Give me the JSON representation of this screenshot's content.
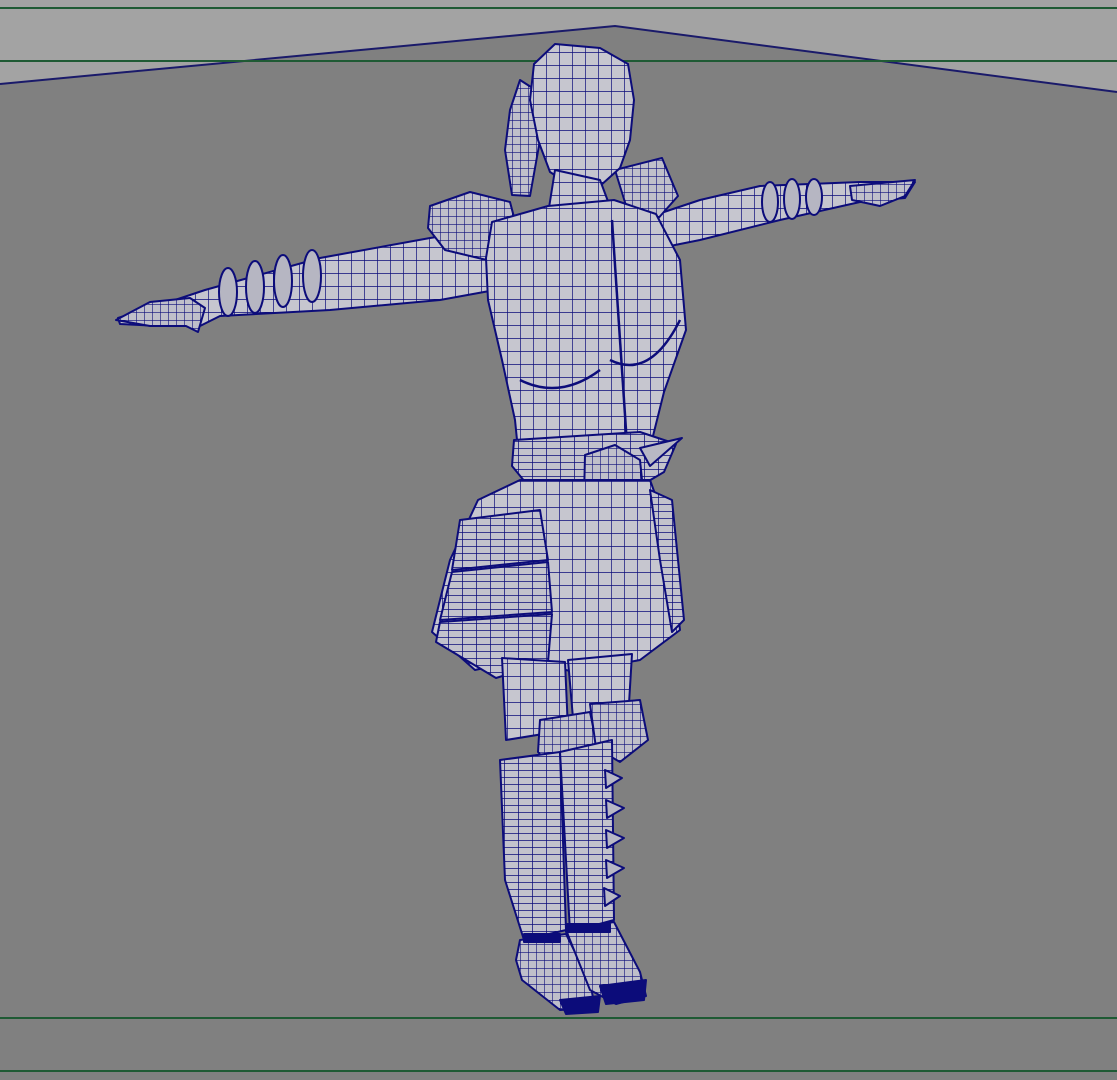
{
  "viewport": {
    "panel": "3d-perspective-viewport",
    "shading": "wireframe-on-shaded",
    "colors": {
      "background": "#808080",
      "backdrop_wall": "#a3a3a3",
      "mesh_fill": "#c6c6cf",
      "wireframe": "#0c0c7a",
      "resolution_gate": "#1f5a34"
    }
  },
  "scene": {
    "model": "armored-female-character-tpose"
  }
}
